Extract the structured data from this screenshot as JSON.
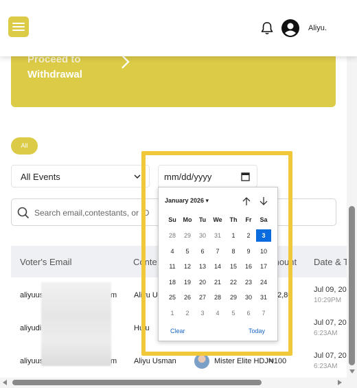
{
  "header": {
    "user_name": "Aliyu."
  },
  "withdraw": {
    "line1": "Proceed to",
    "line2": "Withdrawal"
  },
  "filters": {
    "all_label": "All",
    "events_selected": "All Events",
    "date_placeholder": "mm/dd/yyyy",
    "search_placeholder": "Search email,contestants, or ID"
  },
  "table": {
    "columns": [
      "Voter's Email",
      "Conte",
      "mount",
      "Date & T"
    ],
    "rows": [
      {
        "email": "aliyuus",
        "email_tail": "m",
        "contestant": "Aliyu U",
        "amount": "2,8​0",
        "date": "Jul 09, 20",
        "time": "10:29PM"
      },
      {
        "email": "aliyudi",
        "email_tail": "",
        "contestant": "Hulu",
        "amount": "",
        "date": "Jul 07, 20",
        "time": "6:23AM"
      },
      {
        "email": "aliyuus",
        "email_tail": "m",
        "contestant": "Aliyu Usman",
        "amount": "Mister Elite HDJ₦100",
        "date": "Jul 07, 20",
        "time": "6:23AM"
      }
    ]
  },
  "calendar": {
    "month_label": "January 2026 ▾",
    "weekdays": [
      "Su",
      "Mo",
      "Tu",
      "We",
      "Th",
      "Fr",
      "Sa"
    ],
    "weeks": [
      [
        "28",
        "29",
        "30",
        "31",
        "1",
        "2",
        "3"
      ],
      [
        "4",
        "5",
        "6",
        "7",
        "8",
        "9",
        "10"
      ],
      [
        "11",
        "12",
        "13",
        "14",
        "15",
        "16",
        "17"
      ],
      [
        "18",
        "19",
        "20",
        "21",
        "22",
        "23",
        "24"
      ],
      [
        "25",
        "26",
        "27",
        "28",
        "29",
        "30",
        "31"
      ],
      [
        "1",
        "2",
        "3",
        "4",
        "5",
        "6",
        "7"
      ]
    ],
    "selected": "3",
    "clear_label": "Clear",
    "today_label": "Today"
  },
  "colors": {
    "accent": "#dccb47",
    "highlight": "#f1c83a",
    "selected_day": "#0a6cdf"
  },
  "icons": [
    "menu-icon",
    "bell-icon",
    "account-icon",
    "chevron-right-icon",
    "chevron-down-icon",
    "calendar-icon",
    "search-icon",
    "arrow-up-icon",
    "arrow-down-icon"
  ]
}
